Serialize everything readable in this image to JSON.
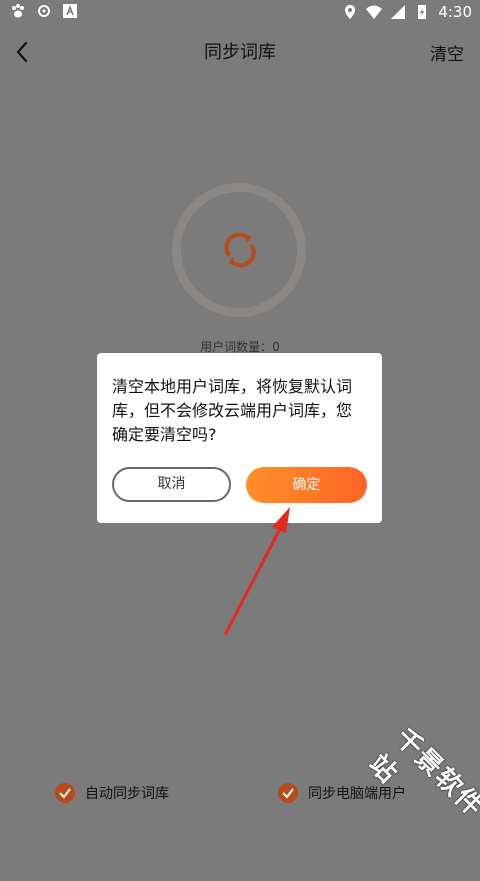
{
  "status_bar": {
    "time": "4:30",
    "left_icons": [
      "paw-icon",
      "gear-icon",
      "a-icon"
    ],
    "right_icons": [
      "location-icon",
      "wifi-icon",
      "signal-icon",
      "battery-icon"
    ]
  },
  "app_bar": {
    "title": "同步词库",
    "back_icon": "chevron-left-icon",
    "clear_label": "清空"
  },
  "sync": {
    "icon": "sync-icon",
    "user_word_count_label": "用户词数量：0"
  },
  "dialog": {
    "message": "清空本地用户词库，将恢复默认词库，但不会修改云端用户词库，您确定要清空吗?",
    "cancel_label": "取消",
    "ok_label": "确定"
  },
  "bottom_options": [
    {
      "label": "自动同步词库",
      "checked": true
    },
    {
      "label": "同步电脑端用户",
      "checked": true
    }
  ],
  "watermark_text": "千景软件站",
  "colors": {
    "overlay": "#7b7b7b",
    "accent_start": "#ff8f29",
    "accent_end": "#ff6525",
    "check": "#b94a1c",
    "annotation_arrow": "#e62a1e"
  }
}
